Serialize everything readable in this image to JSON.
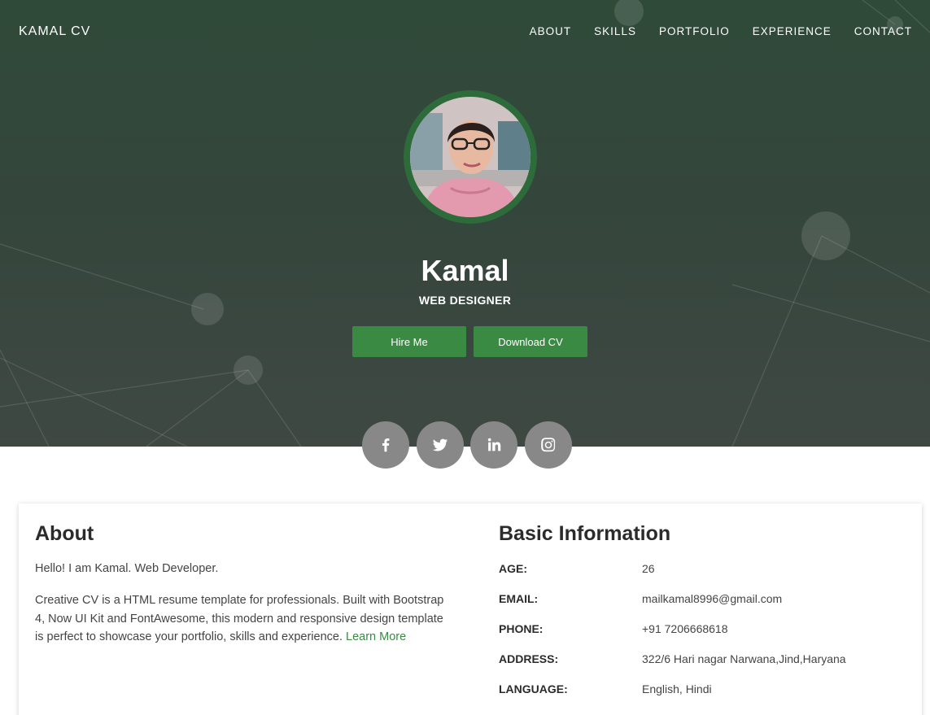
{
  "nav": {
    "brand": "KAMAL CV",
    "items": [
      {
        "label": "ABOUT"
      },
      {
        "label": "SKILLS"
      },
      {
        "label": "PORTFOLIO"
      },
      {
        "label": "EXPERIENCE"
      },
      {
        "label": "CONTACT"
      }
    ]
  },
  "hero": {
    "name": "Kamal",
    "role": "WEB DESIGNER",
    "hire_label": "Hire Me",
    "download_label": "Download CV"
  },
  "social": [
    {
      "icon": "facebook-icon"
    },
    {
      "icon": "twitter-icon"
    },
    {
      "icon": "linkedin-icon"
    },
    {
      "icon": "instagram-icon"
    }
  ],
  "about": {
    "title": "About",
    "intro": "Hello! I am Kamal. Web Developer.",
    "body": "Creative CV is a HTML resume template for professionals. Built with Bootstrap 4, Now UI Kit and FontAwesome, this modern and responsive design template is perfect to showcase your portfolio, skills and experience.",
    "link_label": "Learn More"
  },
  "info": {
    "title": "Basic Information",
    "rows": [
      {
        "label": "AGE:",
        "value": "26"
      },
      {
        "label": "EMAIL:",
        "value": "mailkamal8996@gmail.com"
      },
      {
        "label": "PHONE:",
        "value": "+91 7206668618"
      },
      {
        "label": "ADDRESS:",
        "value": "322/6 Hari nagar Narwana,Jind,Haryana"
      },
      {
        "label": "LANGUAGE:",
        "value": "English, Hindi"
      }
    ]
  },
  "colors": {
    "accent": "#3a8a44",
    "avatar_ring": "#2e6b3a",
    "social_bg": "#888888"
  }
}
